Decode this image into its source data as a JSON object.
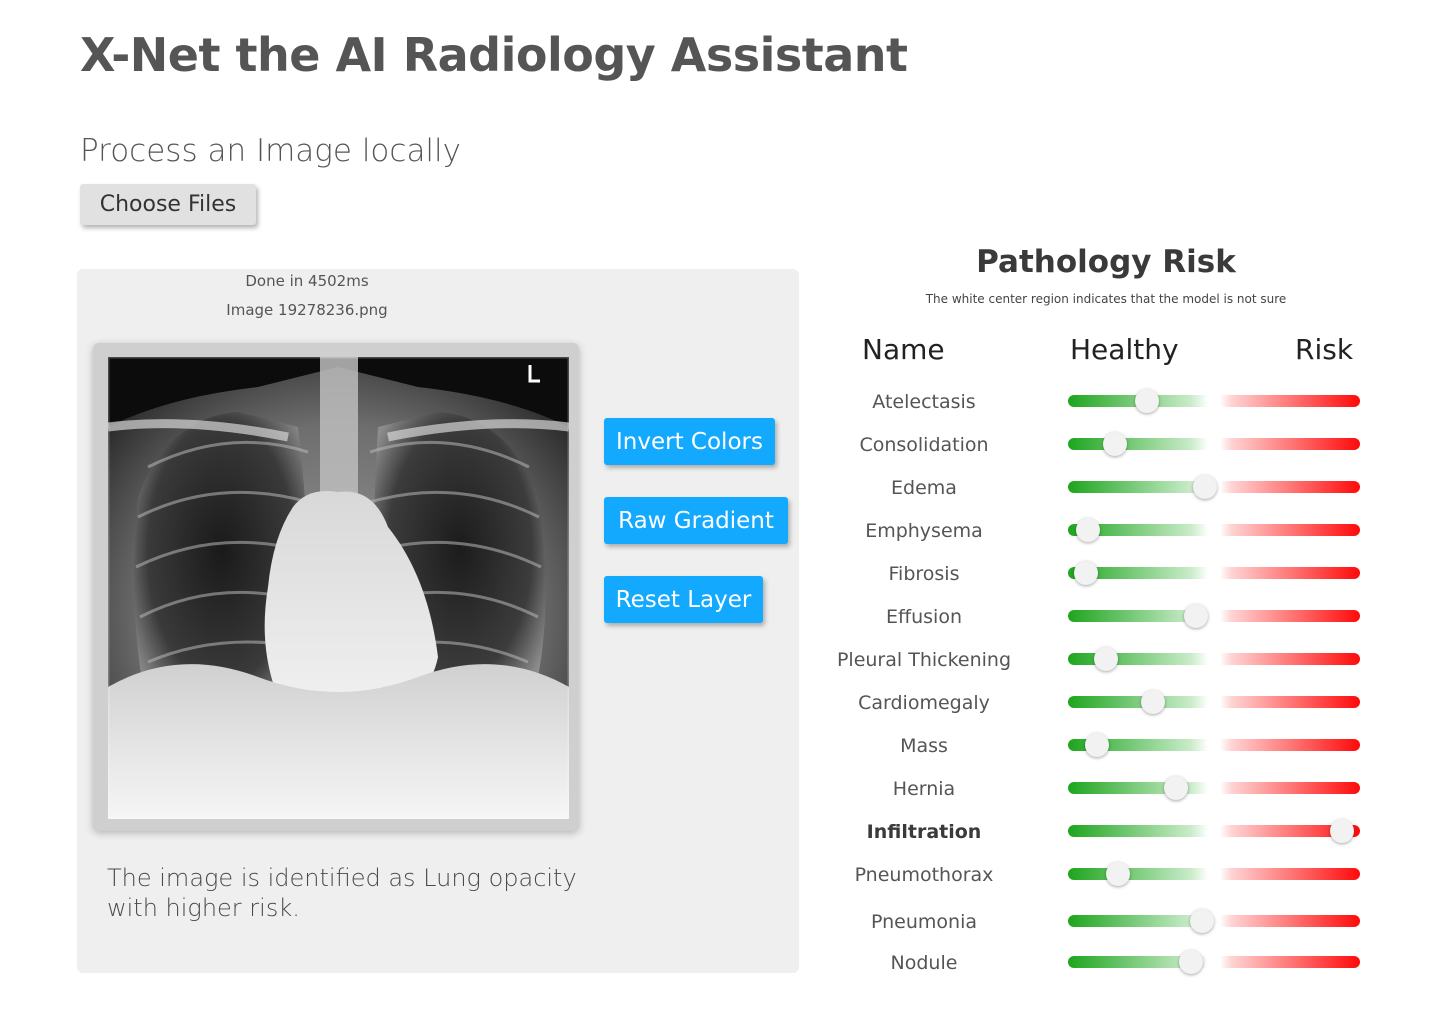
{
  "app": {
    "title": "X-Net the AI Radiology Assistant"
  },
  "upload": {
    "section_title": "Process an Image locally",
    "choose_files_label": "Choose Files"
  },
  "viewer": {
    "status_text": "Done in 4502ms",
    "image_name": "Image 19278236.png",
    "buttons": {
      "invert_colors": "Invert Colors",
      "raw_gradient": "Raw Gradient",
      "reset_layer": "Reset Layer"
    },
    "diagnosis_text": "The image  is identified as Lung opacity\nwith higher risk."
  },
  "pathology": {
    "title": "Pathology Risk",
    "subtitle": "The white center region indicates that the model is not sure",
    "headers": {
      "name": "Name",
      "healthy": "Healthy",
      "risk": "Risk"
    },
    "items": [
      {
        "name": "Atelectasis",
        "risk": 0.27,
        "bold": false
      },
      {
        "name": "Consolidation",
        "risk": 0.16,
        "bold": false
      },
      {
        "name": "Edema",
        "risk": 0.47,
        "bold": false
      },
      {
        "name": "Emphysema",
        "risk": 0.07,
        "bold": false
      },
      {
        "name": "Fibrosis",
        "risk": 0.06,
        "bold": false
      },
      {
        "name": "Effusion",
        "risk": 0.44,
        "bold": false
      },
      {
        "name": "Pleural Thickening",
        "risk": 0.13,
        "bold": false
      },
      {
        "name": "Cardiomegaly",
        "risk": 0.29,
        "bold": false
      },
      {
        "name": "Mass",
        "risk": 0.1,
        "bold": false
      },
      {
        "name": "Hernia",
        "risk": 0.37,
        "bold": false
      },
      {
        "name": "Infiltration",
        "risk": 0.94,
        "bold": true
      },
      {
        "name": "Pneumothorax",
        "risk": 0.17,
        "bold": false
      },
      {
        "name": "Pneumonia",
        "risk": 0.46,
        "bold": false
      },
      {
        "name": "Nodule",
        "risk": 0.42,
        "bold": false
      }
    ]
  },
  "colors": {
    "button_blue": "#12a9ff",
    "healthy_green": "#1ea51e",
    "risk_red": "#ff0a0a",
    "panel_gray": "#efefef"
  }
}
